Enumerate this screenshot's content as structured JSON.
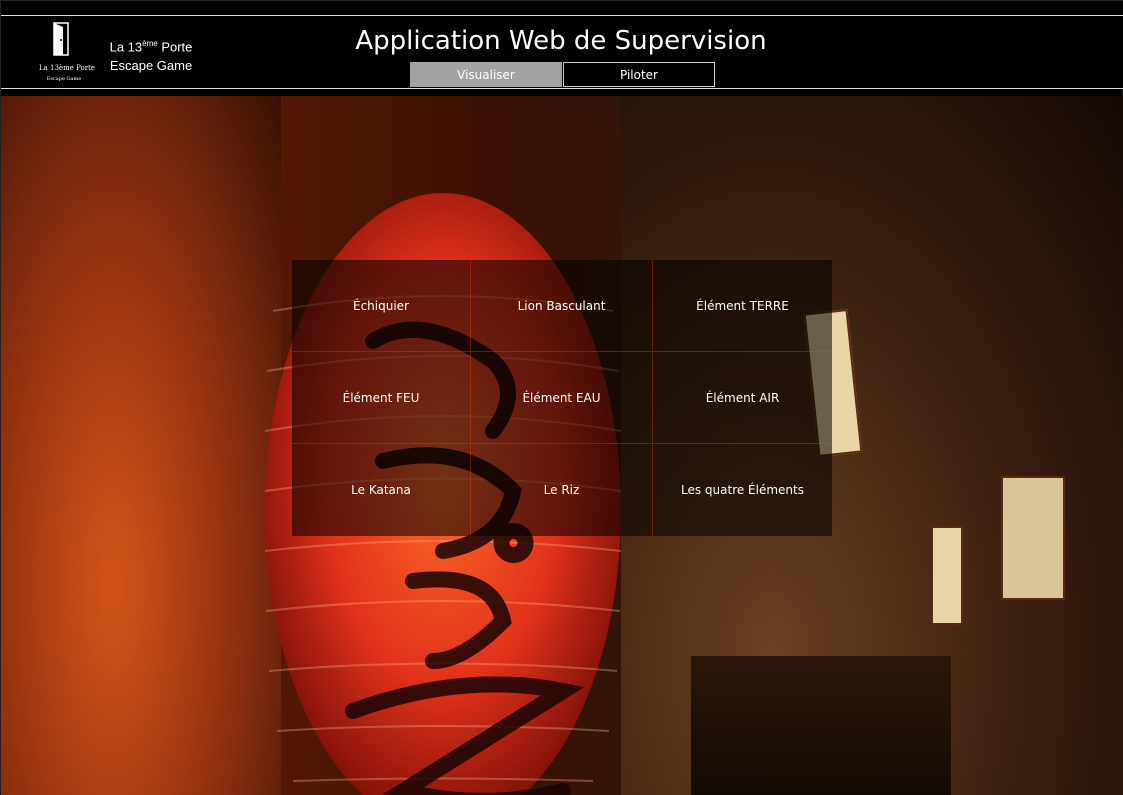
{
  "header": {
    "logo": {
      "name": "La 13ème Porte",
      "sub": "Escape Game"
    },
    "brand": {
      "line1_prefix": "La 13",
      "line1_sup": "ème",
      "line1_suffix": " Porte",
      "line2": "Escape Game"
    },
    "title": "Application Web de Supervision",
    "tabs": [
      {
        "label": "Visualiser",
        "active": true
      },
      {
        "label": "Piloter",
        "active": false
      }
    ]
  },
  "grid": {
    "items": [
      {
        "label": "Échiquier"
      },
      {
        "label": "Lion Basculant"
      },
      {
        "label": "Élément TERRE"
      },
      {
        "label": "Élément FEU"
      },
      {
        "label": "Élément EAU"
      },
      {
        "label": "Élément AIR"
      },
      {
        "label": "Le Katana"
      },
      {
        "label": "Le Riz"
      },
      {
        "label": "Les quatre Éléments"
      }
    ]
  },
  "colors": {
    "tab_active_bg": "#a3a3a3",
    "header_bg": "#000000",
    "lantern_red": "#e0301a"
  }
}
